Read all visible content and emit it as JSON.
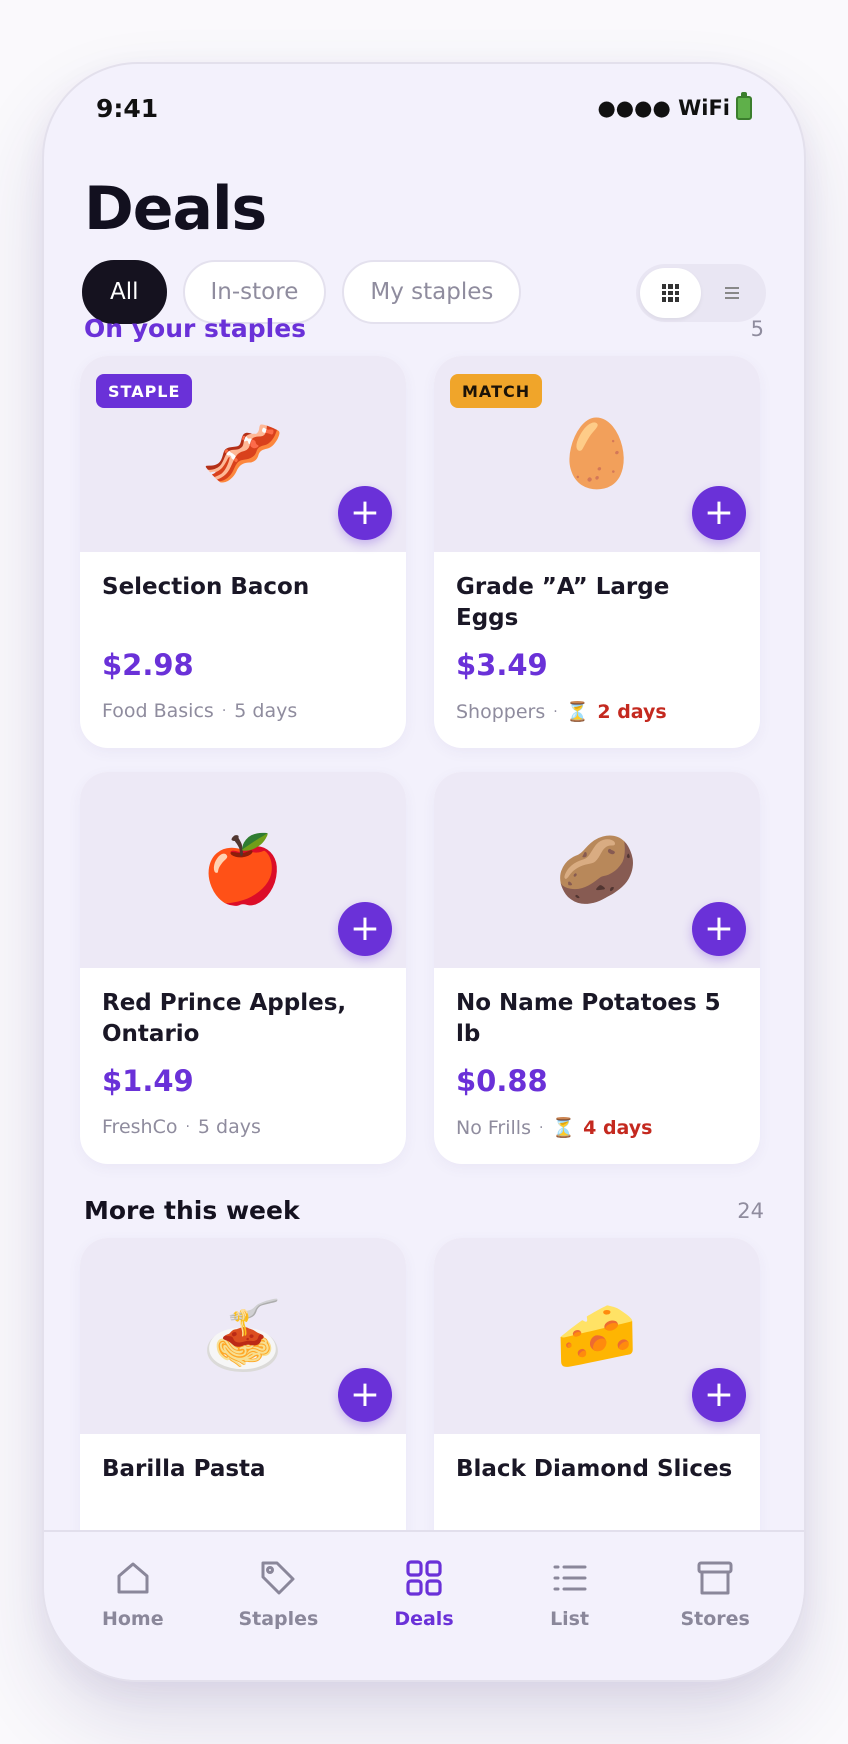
{
  "status": {
    "time": "9:41",
    "signal": "●●●● WiFi",
    "battery_icon": "battery-icon"
  },
  "title": "Deals",
  "filters": [
    {
      "label": "All",
      "active": true
    },
    {
      "label": "In-store",
      "active": false
    },
    {
      "label": "My staples",
      "active": false
    }
  ],
  "view_toggle": {
    "grid_icon": "grid-view-icon",
    "list_icon": "list-view-icon",
    "selected": "grid"
  },
  "sections": {
    "staples": {
      "title": "On your staples",
      "count": "5"
    },
    "more": {
      "title": "More this week",
      "count": "24"
    }
  },
  "cards": [
    {
      "emoji": "🥓",
      "icon": "bacon-icon",
      "badge": "STAPLE",
      "name": "Selection Bacon",
      "price": "$2.98",
      "store": "Food Basics",
      "sep": "·",
      "expires": "5 days",
      "urgent": false
    },
    {
      "emoji": "🥚",
      "icon": "egg-icon",
      "badge": "MATCH",
      "name": "Grade ”A” Large Eggs",
      "price": "$3.49",
      "store": "Shoppers",
      "sep": "·",
      "hourglass": "⏳",
      "expires": "2 days",
      "urgent": true
    },
    {
      "emoji": "🍎",
      "icon": "apple-icon",
      "badge": "",
      "name": "Red Prince Apples, Ontario",
      "price": "$1.49",
      "store": "FreshCo",
      "sep": "·",
      "expires": "5 days",
      "urgent": false
    },
    {
      "emoji": "🥔",
      "icon": "potato-icon",
      "badge": "",
      "name": "No Name Potatoes 5 lb",
      "price": "$0.88",
      "store": "No Frills",
      "sep": "·",
      "hourglass": "⏳",
      "expires": "4 days",
      "urgent": true
    },
    {
      "emoji": "🍝",
      "icon": "pasta-icon",
      "badge": "",
      "name": "Barilla Pasta"
    },
    {
      "emoji": "🧀",
      "icon": "cheese-icon",
      "badge": "",
      "name": "Black Diamond Slices"
    }
  ],
  "add_label": "+",
  "tabs": [
    {
      "label": "Home",
      "icon": "home-icon",
      "active": false
    },
    {
      "label": "Staples",
      "icon": "tag-icon",
      "active": false
    },
    {
      "label": "Deals",
      "icon": "grid-icon",
      "active": true
    },
    {
      "label": "List",
      "icon": "list-icon",
      "active": false
    },
    {
      "label": "Stores",
      "icon": "store-icon",
      "active": false
    }
  ],
  "colors": {
    "accent": "#6a31d8",
    "urgent": "#c4291f",
    "match": "#f0a52a",
    "background": "#f3f1fc"
  }
}
